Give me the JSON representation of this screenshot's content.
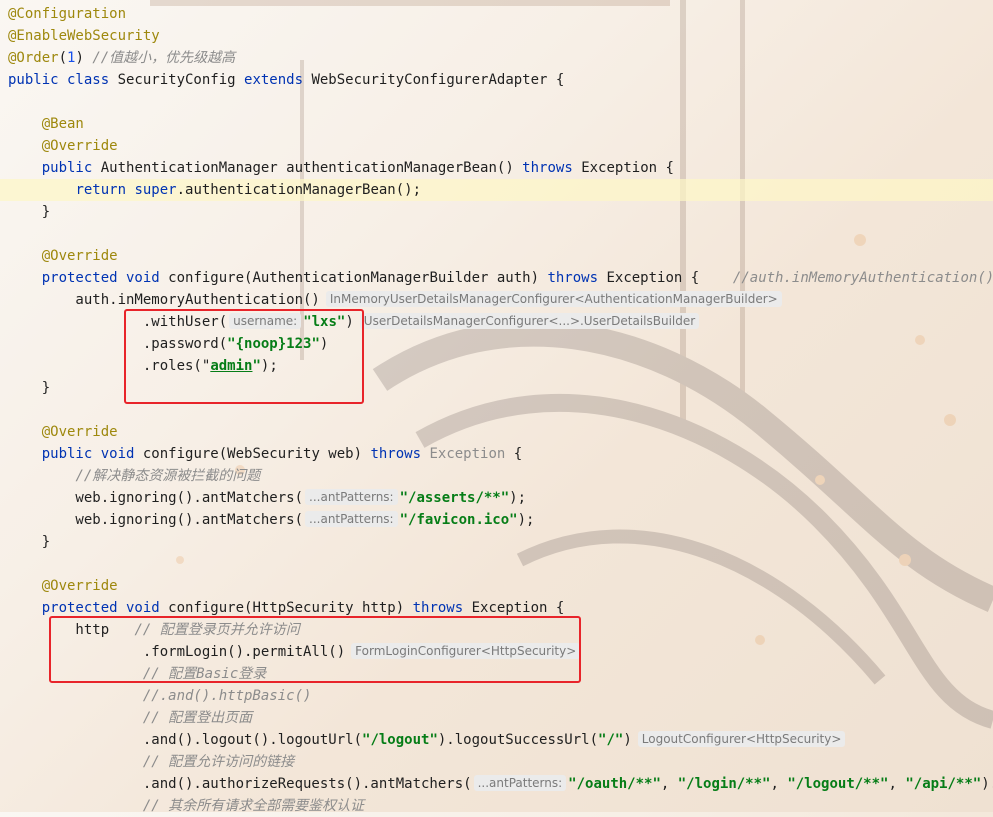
{
  "lines": [
    {
      "segs": [
        {
          "t": "@Configuration",
          "c": "ann"
        }
      ]
    },
    {
      "segs": [
        {
          "t": "@EnableWebSecurity",
          "c": "ann"
        }
      ]
    },
    {
      "segs": [
        {
          "t": "@Order",
          "c": "ann"
        },
        {
          "t": "("
        },
        {
          "t": "1",
          "c": "num"
        },
        {
          "t": ") "
        },
        {
          "t": "//值越小，优先级越高",
          "c": "cmt"
        }
      ]
    },
    {
      "segs": [
        {
          "t": "public class ",
          "c": "kw"
        },
        {
          "t": "SecurityConfig "
        },
        {
          "t": "extends ",
          "c": "kw"
        },
        {
          "t": "WebSecurityConfigurerAdapter {"
        }
      ]
    },
    {
      "segs": []
    },
    {
      "segs": [
        {
          "t": "    "
        },
        {
          "t": "@Bean",
          "c": "ann"
        }
      ]
    },
    {
      "segs": [
        {
          "t": "    "
        },
        {
          "t": "@Override",
          "c": "ann"
        }
      ]
    },
    {
      "segs": [
        {
          "t": "    "
        },
        {
          "t": "public ",
          "c": "kw"
        },
        {
          "t": "AuthenticationManager authenticationManagerBean() "
        },
        {
          "t": "throws ",
          "c": "kw"
        },
        {
          "t": "Exception {"
        }
      ]
    },
    {
      "hl": true,
      "segs": [
        {
          "t": "        "
        },
        {
          "t": "return super",
          "c": "kw"
        },
        {
          "t": ".authenticationManagerBean();"
        }
      ]
    },
    {
      "segs": [
        {
          "t": "    }"
        }
      ]
    },
    {
      "segs": []
    },
    {
      "segs": [
        {
          "t": "    "
        },
        {
          "t": "@Override",
          "c": "ann"
        }
      ]
    },
    {
      "segs": [
        {
          "t": "    "
        },
        {
          "t": "protected void ",
          "c": "kw"
        },
        {
          "t": "configure(AuthenticationManagerBuilder auth) "
        },
        {
          "t": "throws ",
          "c": "kw"
        },
        {
          "t": "Exception {    "
        },
        {
          "t": "//auth.inMemoryAuthentication()",
          "c": "cmt"
        }
      ]
    },
    {
      "segs": [
        {
          "t": "        auth.inMemoryAuthentication()"
        },
        {
          "t": "InMemoryUserDetailsManagerConfigurer<AuthenticationManagerBuilder>",
          "c": "hint type"
        }
      ]
    },
    {
      "segs": [
        {
          "t": "                .withUser("
        },
        {
          "t": "username:",
          "c": "hint"
        },
        {
          "t": "\"lxs\"",
          "c": "str"
        },
        {
          "t": ")"
        },
        {
          "t": "UserDetailsManagerConfigurer<...>.UserDetailsBuilder",
          "c": "hint type"
        }
      ]
    },
    {
      "segs": [
        {
          "t": "                .password("
        },
        {
          "t": "\"{noop}123\"",
          "c": "str"
        },
        {
          "t": ")"
        }
      ]
    },
    {
      "segs": [
        {
          "t": "                .roles("
        },
        {
          "t": "\""
        },
        {
          "t": "admin",
          "c": "str ul"
        },
        {
          "t": "\"",
          "c": "str"
        },
        {
          "t": ");"
        }
      ]
    },
    {
      "segs": [
        {
          "t": "    }"
        }
      ]
    },
    {
      "segs": []
    },
    {
      "segs": [
        {
          "t": "    "
        },
        {
          "t": "@Override",
          "c": "ann"
        }
      ]
    },
    {
      "segs": [
        {
          "t": "    "
        },
        {
          "t": "public void ",
          "c": "kw"
        },
        {
          "t": "configure(WebSecurity web) "
        },
        {
          "t": "throws ",
          "c": "kw"
        },
        {
          "t": "Exception",
          "c": "cmt-plain"
        },
        {
          "t": " {"
        }
      ]
    },
    {
      "segs": [
        {
          "t": "        "
        },
        {
          "t": "//解决静态资源被拦截的问题",
          "c": "cmt"
        }
      ]
    },
    {
      "segs": [
        {
          "t": "        web.ignoring().antMatchers("
        },
        {
          "t": "...antPatterns:",
          "c": "hint"
        },
        {
          "t": "\"/asserts/**\"",
          "c": "str"
        },
        {
          "t": ");"
        }
      ]
    },
    {
      "segs": [
        {
          "t": "        web.ignoring().antMatchers("
        },
        {
          "t": "...antPatterns:",
          "c": "hint"
        },
        {
          "t": "\"/favicon.ico\"",
          "c": "str"
        },
        {
          "t": ");"
        }
      ]
    },
    {
      "segs": [
        {
          "t": "    }"
        }
      ]
    },
    {
      "segs": []
    },
    {
      "segs": [
        {
          "t": "    "
        },
        {
          "t": "@Override",
          "c": "ann"
        }
      ]
    },
    {
      "segs": [
        {
          "t": "    "
        },
        {
          "t": "protected void ",
          "c": "kw"
        },
        {
          "t": "configure(HttpSecurity http) "
        },
        {
          "t": "throws ",
          "c": "kw"
        },
        {
          "t": "Exception {"
        }
      ]
    },
    {
      "segs": [
        {
          "t": "        http   "
        },
        {
          "t": "// 配置登录页并允许访问",
          "c": "cmt"
        }
      ]
    },
    {
      "segs": [
        {
          "t": "                .formLogin().permitAll()"
        },
        {
          "t": "FormLoginConfigurer<HttpSecurity>",
          "c": "hint type"
        }
      ]
    },
    {
      "segs": [
        {
          "t": "                "
        },
        {
          "t": "// 配置Basic登录",
          "c": "cmt"
        }
      ]
    },
    {
      "segs": [
        {
          "t": "                "
        },
        {
          "t": "//.and().httpBasic()",
          "c": "cmt"
        }
      ]
    },
    {
      "segs": [
        {
          "t": "                "
        },
        {
          "t": "// 配置登出页面",
          "c": "cmt"
        }
      ]
    },
    {
      "segs": [
        {
          "t": "                .and().logout().logoutUrl("
        },
        {
          "t": "\"/logout\"",
          "c": "str"
        },
        {
          "t": ").logoutSuccessUrl("
        },
        {
          "t": "\"/\"",
          "c": "str"
        },
        {
          "t": ")"
        },
        {
          "t": "LogoutConfigurer<HttpSecurity>",
          "c": "hint type"
        }
      ]
    },
    {
      "segs": [
        {
          "t": "                "
        },
        {
          "t": "// 配置允许访问的链接",
          "c": "cmt"
        }
      ]
    },
    {
      "segs": [
        {
          "t": "                .and().authorizeRequests().antMatchers("
        },
        {
          "t": "...antPatterns:",
          "c": "hint"
        },
        {
          "t": "\"/oauth/**\"",
          "c": "str"
        },
        {
          "t": ", "
        },
        {
          "t": "\"/login/**\"",
          "c": "str"
        },
        {
          "t": ", "
        },
        {
          "t": "\"/logout/**\"",
          "c": "str"
        },
        {
          "t": ", "
        },
        {
          "t": "\"/api/**\"",
          "c": "str"
        },
        {
          "t": ").permit"
        }
      ]
    },
    {
      "segs": [
        {
          "t": "                "
        },
        {
          "t": "// 其余所有请求全部需要鉴权认证",
          "c": "cmt"
        }
      ]
    }
  ],
  "colors": {
    "annotation": "#9e880d",
    "keyword": "#0033b3",
    "string": "#067d17",
    "comment": "#8c8c8c",
    "number": "#1750eb",
    "highlight": "#fdf7c6",
    "redbox": "#e8242a"
  }
}
